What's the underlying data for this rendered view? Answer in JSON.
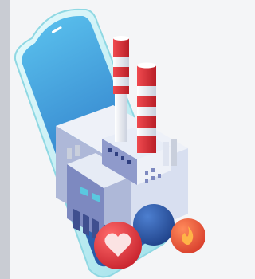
{
  "illustration": {
    "palette": {
      "background": "#f4f5f7",
      "phone_frame": "#bfeef3",
      "screen_top": "#4fb6e8",
      "screen_bottom": "#2c6fb8",
      "chimney_red": "#d8313a",
      "chimney_white": "#eef1f5",
      "building_light": "#e6ebf5",
      "building_mid": "#aeb8d8",
      "building_dark": "#6d7bb1",
      "window": "#5ac8e0",
      "heart_ball": "#e83a3f",
      "blue_ball": "#2d58a8",
      "fire_ball": "#f05a3a"
    },
    "icons": [
      "heart-icon",
      "fire-icon"
    ]
  }
}
